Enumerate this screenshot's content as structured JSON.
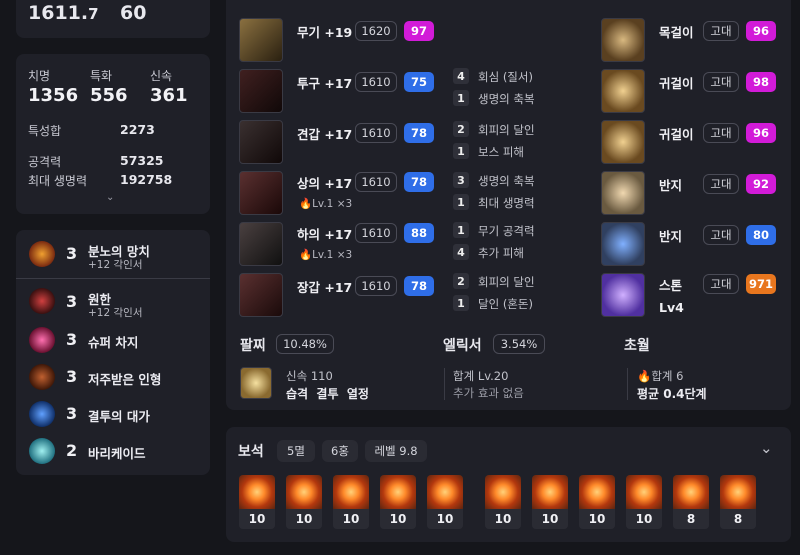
{
  "top": {
    "item_level": "1611.",
    "item_level_dec": "7",
    "combat_level": "60"
  },
  "stats": {
    "crit_label": "치명",
    "crit": "1356",
    "spec_label": "특화",
    "spec": "556",
    "swift_label": "신속",
    "swift": "361",
    "total_label": "특성합",
    "total": "2273",
    "atk_label": "공격력",
    "atk": "57325",
    "hp_label": "최대 생명력",
    "hp": "192758"
  },
  "engravings": [
    {
      "level": "3",
      "name": "분노의 망치",
      "sub": "+12 각인서"
    },
    {
      "level": "3",
      "name": "원한",
      "sub": "+12 각인서"
    },
    {
      "level": "3",
      "name": "슈퍼 차지",
      "sub": ""
    },
    {
      "level": "3",
      "name": "저주받은 인형",
      "sub": ""
    },
    {
      "level": "3",
      "name": "결투의 대가",
      "sub": ""
    },
    {
      "level": "2",
      "name": "바리케이드",
      "sub": ""
    }
  ],
  "equipment": [
    {
      "name": "무기 +19",
      "ilvl": "1620",
      "quality": "97",
      "quality_color": "#d21bd8",
      "elixir": ""
    },
    {
      "name": "투구 +17",
      "ilvl": "1610",
      "quality": "75",
      "quality_color": "#2f6ee8",
      "elixir": ""
    },
    {
      "name": "견갑 +17",
      "ilvl": "1610",
      "quality": "78",
      "quality_color": "#2f6ee8",
      "elixir": ""
    },
    {
      "name": "상의 +17",
      "ilvl": "1610",
      "quality": "78",
      "quality_color": "#2f6ee8",
      "elixir": "Lv.1",
      "elixir_mult": "×3"
    },
    {
      "name": "하의 +17",
      "ilvl": "1610",
      "quality": "88",
      "quality_color": "#2f6ee8",
      "elixir": "Lv.1",
      "elixir_mult": "×3"
    },
    {
      "name": "장갑 +17",
      "ilvl": "1610",
      "quality": "78",
      "quality_color": "#2f6ee8",
      "elixir": ""
    }
  ],
  "elixir_effects": [
    {
      "n": "4",
      "t": "회심 (질서)"
    },
    {
      "n": "1",
      "t": "생명의 축복"
    },
    {
      "n": "2",
      "t": "회피의 달인"
    },
    {
      "n": "1",
      "t": "보스 피해"
    },
    {
      "n": "3",
      "t": "생명의 축복"
    },
    {
      "n": "1",
      "t": "최대 생명력"
    },
    {
      "n": "1",
      "t": "무기 공격력"
    },
    {
      "n": "4",
      "t": "추가 피해"
    },
    {
      "n": "2",
      "t": "회피의 달인"
    },
    {
      "n": "1",
      "t": "달인 (혼돈)"
    }
  ],
  "accessories": [
    {
      "name": "목걸이",
      "grade": "고대",
      "quality": "96",
      "quality_color": "#d21bd8"
    },
    {
      "name": "귀걸이",
      "grade": "고대",
      "quality": "98",
      "quality_color": "#d21bd8"
    },
    {
      "name": "귀걸이",
      "grade": "고대",
      "quality": "96",
      "quality_color": "#d21bd8"
    },
    {
      "name": "반지",
      "grade": "고대",
      "quality": "92",
      "quality_color": "#d21bd8"
    },
    {
      "name": "반지",
      "grade": "고대",
      "quality": "80",
      "quality_color": "#2f6ee8"
    },
    {
      "name": "스톤",
      "grade": "고대",
      "quality": "971",
      "quality_color": "#e8761e",
      "sub": "Lv4"
    }
  ],
  "bracelet": {
    "label": "팔찌",
    "pct": "10.48%",
    "line1": "신속 110",
    "line2": "습격  결투  열정"
  },
  "elixir": {
    "label": "엘릭서",
    "pct": "3.54%",
    "line1": "합계 Lv.20",
    "line2": "추가 효과 없음"
  },
  "transcend": {
    "label": "초월",
    "line1": "합계 6",
    "line2": "평균 0.4단계"
  },
  "gems": {
    "label": "보석",
    "count": "5멸",
    "count2": "6홍",
    "level": "레벨 9.8",
    "levels": [
      "10",
      "10",
      "10",
      "10",
      "10",
      "10",
      "10",
      "10",
      "10",
      "8",
      "8"
    ]
  }
}
